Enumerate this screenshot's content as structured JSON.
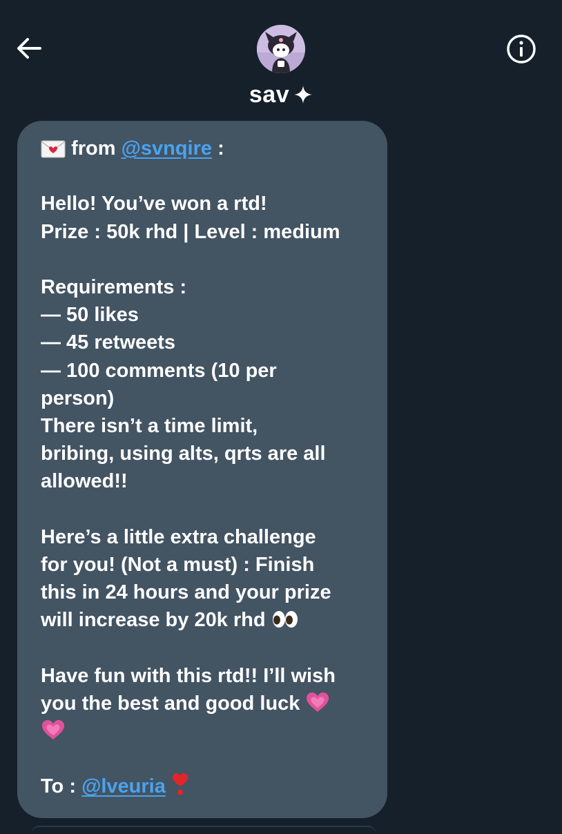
{
  "header": {
    "display_name": "sav",
    "sparkle_glyph": "✦",
    "back_icon": "arrow-left-icon",
    "info_icon": "info-icon",
    "avatar_icon": "kuromi-avatar"
  },
  "message": {
    "from_prefix": "from",
    "from_handle": "@svnqire",
    "from_suffix": " :",
    "greeting": "Hello! You’ve won a rtd!",
    "prize_line": "Prize : 50k rhd | Level : medium",
    "requirements_title": "Requirements :",
    "req_1": "— 50 likes",
    "req_2": "— 45 retweets",
    "req_3a": "— 100 comments (10 per",
    "req_3b": "person)",
    "rules_1": "There isn’t a time limit,",
    "rules_2": "bribing, using alts, qrts are all",
    "rules_3": "allowed!!",
    "extra_1": "Here’s a little extra challenge",
    "extra_2": "for you! (Not a must) : Finish",
    "extra_3": "this in 24 hours and your prize",
    "extra_4": "will increase by 20k rhd",
    "closing_1": "Have fun with this rtd!! I’ll wish",
    "closing_2": "you the best and good luck",
    "to_prefix": "To :",
    "to_handle": "@lveuria"
  },
  "colors": {
    "background": "#15202b",
    "bubble": "#435463",
    "mention": "#4aa3ef",
    "text": "#ffffff"
  }
}
